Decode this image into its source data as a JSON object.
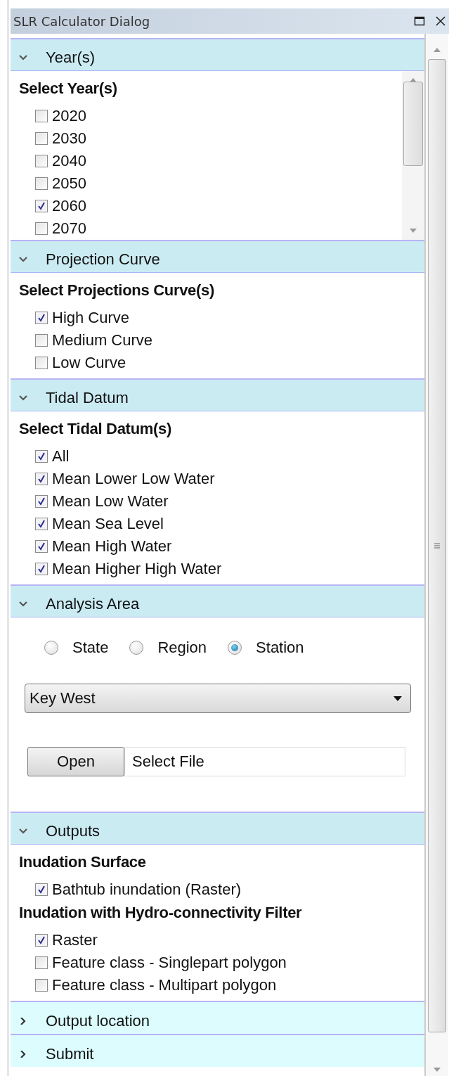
{
  "window": {
    "title": "SLR Calculator Dialog"
  },
  "sections": [
    {
      "title": "Year(s)",
      "expanded": true,
      "kind": "scroll_checklist",
      "groups": [
        {
          "heading": "Select Year(s)",
          "items": [
            {
              "label": "2020",
              "checked": false
            },
            {
              "label": "2030",
              "checked": false
            },
            {
              "label": "2040",
              "checked": false
            },
            {
              "label": "2050",
              "checked": false
            },
            {
              "label": "2060",
              "checked": true
            },
            {
              "label": "2070",
              "checked": false
            }
          ]
        }
      ]
    },
    {
      "title": "Projection Curve",
      "expanded": true,
      "kind": "checklist",
      "groups": [
        {
          "heading": "Select Projections Curve(s)",
          "items": [
            {
              "label": "High Curve",
              "checked": true
            },
            {
              "label": "Medium Curve",
              "checked": false
            },
            {
              "label": "Low Curve",
              "checked": false
            }
          ]
        }
      ]
    },
    {
      "title": "Tidal Datum",
      "expanded": true,
      "kind": "checklist",
      "groups": [
        {
          "heading": "Select Tidal Datum(s)",
          "items": [
            {
              "label": "All",
              "checked": true
            },
            {
              "label": "Mean Lower Low Water",
              "checked": true
            },
            {
              "label": "Mean Low Water",
              "checked": true
            },
            {
              "label": "Mean Sea Level",
              "checked": true
            },
            {
              "label": "Mean High Water",
              "checked": true
            },
            {
              "label": "Mean Higher High Water",
              "checked": true
            }
          ]
        }
      ]
    },
    {
      "title": "Analysis Area",
      "expanded": true,
      "kind": "area",
      "radios": [
        {
          "label": "State",
          "selected": false
        },
        {
          "label": "Region",
          "selected": false
        },
        {
          "label": "Station",
          "selected": true
        }
      ],
      "dropdown": {
        "value": "Key West"
      },
      "file": {
        "button": "Open",
        "value": "Select File"
      }
    },
    {
      "title": "Outputs",
      "expanded": true,
      "kind": "checklist",
      "groups": [
        {
          "heading": "Inudation Surface",
          "items": [
            {
              "label": "Bathtub inundation (Raster)",
              "checked": true
            }
          ]
        },
        {
          "heading": "Inudation with Hydro-connectivity Filter",
          "items": [
            {
              "label": "Raster",
              "checked": true
            },
            {
              "label": "Feature class - Singlepart polygon",
              "checked": false
            },
            {
              "label": "Feature class - Multipart polygon",
              "checked": false
            }
          ]
        }
      ]
    },
    {
      "title": "Output location",
      "expanded": false
    },
    {
      "title": "Submit",
      "expanded": false
    }
  ]
}
